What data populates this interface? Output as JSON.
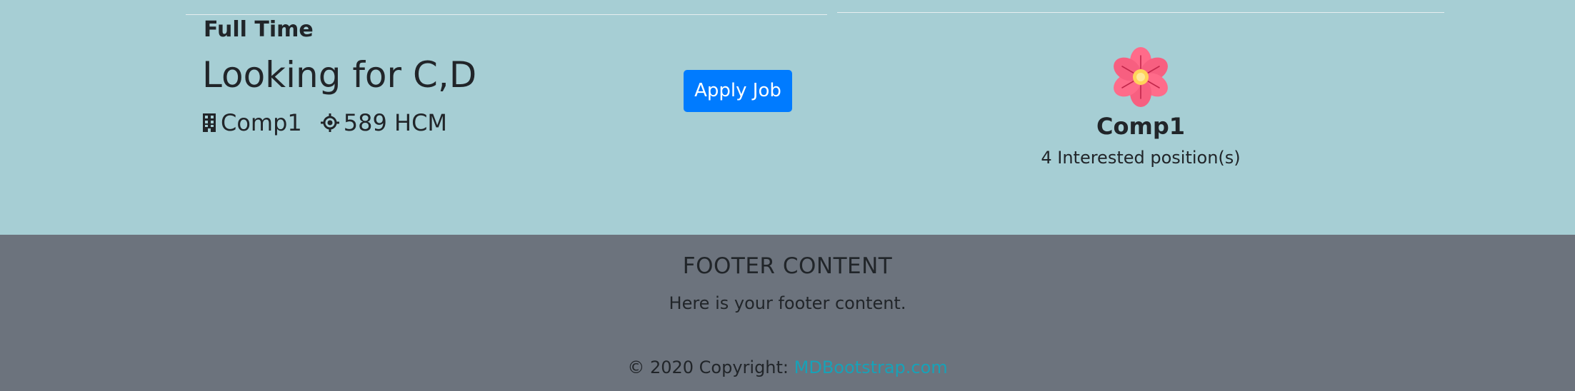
{
  "job": {
    "type": "Full Time",
    "title": "Looking for C,D",
    "company_icon": "building-icon",
    "company": "Comp1",
    "location_icon": "crosshair-location-icon",
    "location": "589 HCM",
    "apply_label": "Apply Job"
  },
  "company_card": {
    "logo_icon": "pink-flower-logo",
    "name": "Comp1",
    "interest": "4 Interested position(s)"
  },
  "footer": {
    "heading": "FOOTER CONTENT",
    "text": "Here is your footer content.",
    "copyright_prefix": "© 2020 Copyright: ",
    "link_label": "MDBootstrap.com"
  },
  "colors": {
    "section_bg": "#a6ced4",
    "footer_bg": "#6c737d",
    "button": "#007bff",
    "link": "#17a2b8",
    "text": "#212529"
  }
}
